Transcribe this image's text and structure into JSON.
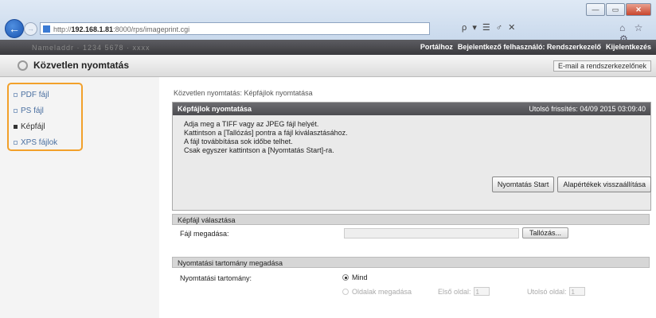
{
  "browser": {
    "url_prefix": "http://",
    "url_host": "192.168.1.81",
    "url_rest": ":8000/rps/imageprint.cgi",
    "search_controls": "ρ ▾ ☰ ♂ ✕",
    "tool_icons": "⌂ ☆ ⚙",
    "window_buttons": [
      "—",
      "▭",
      "✕"
    ]
  },
  "topbar": {
    "left_text": "Nameladdr · 1234 5678 · xxxx",
    "links": [
      "Portálhoz",
      "Bejelentkező felhasználó: Rendszerkezelő",
      "Kijelentkezés"
    ]
  },
  "header": {
    "title": "Közvetlen nyomtatás",
    "mail_link": "E-mail a rendszerkezelőnek"
  },
  "sidebar": {
    "items": [
      {
        "label": "PDF fájl",
        "active": false
      },
      {
        "label": "PS fájl",
        "active": false
      },
      {
        "label": "Képfájl",
        "active": true
      },
      {
        "label": "XPS fájlok",
        "active": false
      }
    ],
    "highlight_color": "#f2a02a"
  },
  "main": {
    "breadcrumb": "Közvetlen nyomtatás: Képfájlok nyomtatása",
    "panel": {
      "title": "Képfájlok nyomtatása",
      "updated": "Utolsó frissítés: 04/09 2015 03:09:40",
      "lines": [
        "Adja meg a TIFF vagy az JPEG fájl helyét.",
        "Kattintson a [Tallózás] pontra a fájl kiválasztásához.",
        "A fájl továbbítása sok időbe telhet.",
        "Csak egyszer kattintson a [Nyomtatás Start]-ra."
      ],
      "start_button": "Nyomtatás Start",
      "reset_button": "Alapértékek visszaállítása"
    },
    "file_section": {
      "heading": "Képfájl választása",
      "label": "Fájl megadása:",
      "browse_button": "Tallózás..."
    },
    "range_section": {
      "heading": "Nyomtatási tartomány megadása",
      "label": "Nyomtatási tartomány:",
      "option_all": "Mind",
      "option_pages": "Oldalak megadása",
      "first_page_label": "Első oldal:",
      "first_page_value": "1",
      "last_page_label": "Utolsó oldal:",
      "last_page_value": "1"
    }
  }
}
